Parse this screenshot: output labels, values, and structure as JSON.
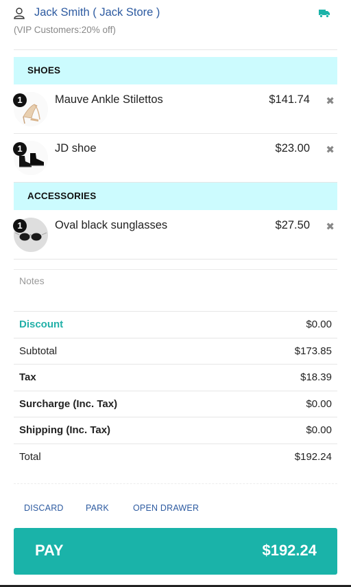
{
  "customer": {
    "name": "Jack Smith ( Jack Store )",
    "group": "(VIP Customers:20% off)",
    "icons": {
      "user": "user-icon",
      "shipping": "truck-icon"
    },
    "colors": {
      "name": "#2c5aa0",
      "truck": "#1ab3a9"
    }
  },
  "categories": [
    {
      "name": "SHOES",
      "items": [
        {
          "qty": "1",
          "name": "Mauve Ankle Stilettos",
          "price": "$141.74",
          "image": "stiletto-thumbnail"
        },
        {
          "qty": "1",
          "name": "JD shoe",
          "price": "$23.00",
          "image": "black-boots-thumbnail"
        }
      ]
    },
    {
      "name": "ACCESSORIES",
      "items": [
        {
          "qty": "1",
          "name": "Oval black sunglasses",
          "price": "$27.50",
          "image": "sunglasses-thumbnail"
        }
      ]
    }
  ],
  "remove_icon": "close-icon",
  "notes": {
    "placeholder": "Notes",
    "value": ""
  },
  "totals": [
    {
      "label": "Discount",
      "value": "$0.00"
    },
    {
      "label": "Subtotal",
      "value": "$173.85"
    },
    {
      "label": "Tax",
      "value": "$18.39"
    },
    {
      "label": "Surcharge (Inc. Tax)",
      "value": "$0.00"
    },
    {
      "label": "Shipping (Inc. Tax)",
      "value": "$0.00"
    },
    {
      "label": "Total",
      "value": "$192.24"
    }
  ],
  "actions": {
    "discard": "DISCARD",
    "park": "PARK",
    "open_drawer": "OPEN DRAWER"
  },
  "pay": {
    "label": "PAY",
    "amount": "$192.24"
  },
  "colors": {
    "accent": "#1ab3a9",
    "category_bg": "#ccfbfe",
    "discount": "#22b0a8",
    "link": "#2c5aa0"
  }
}
